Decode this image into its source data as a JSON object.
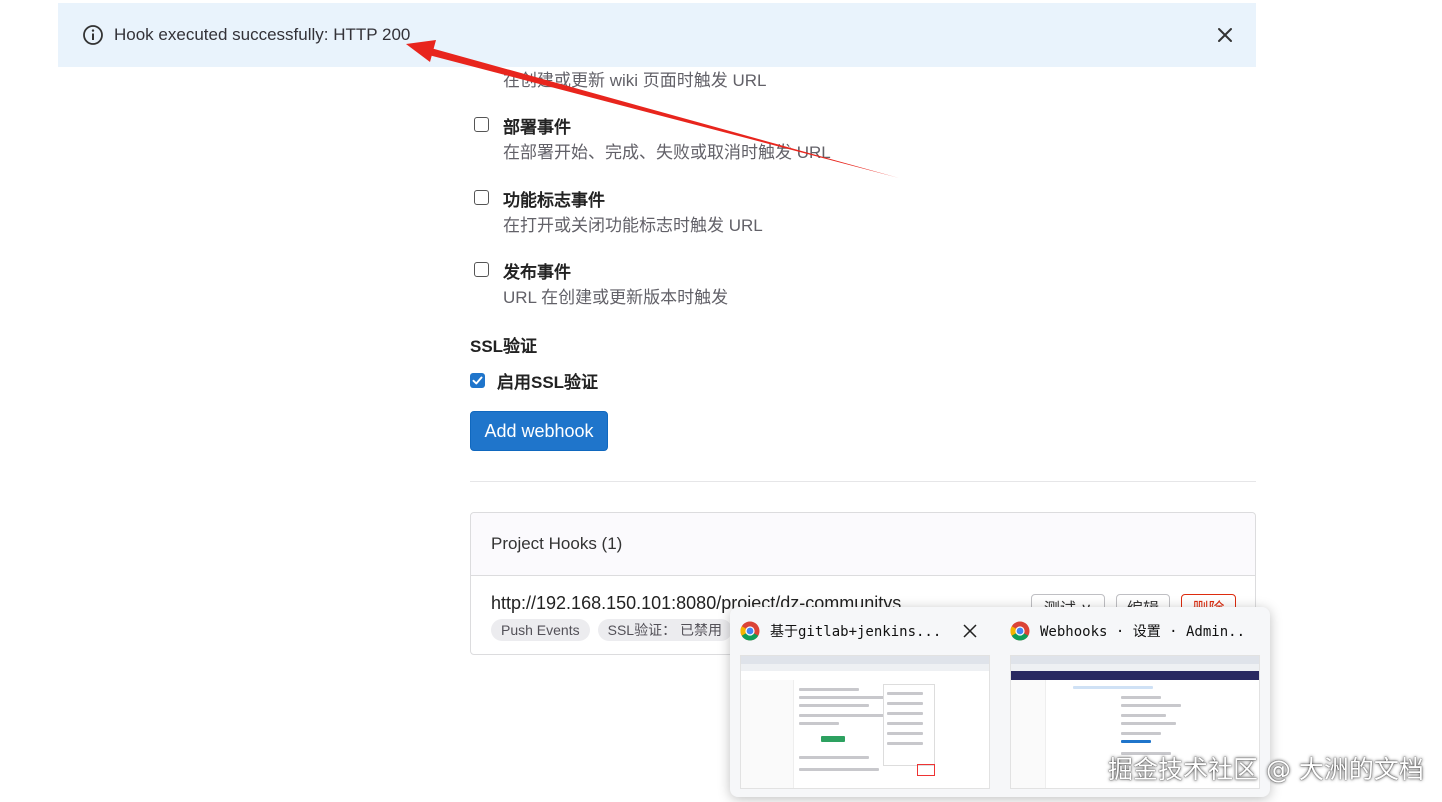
{
  "flash": {
    "message": "Hook executed successfully: HTTP 200"
  },
  "wiki_event": {
    "description": "在创建或更新 wiki 页面时触发 URL"
  },
  "events": [
    {
      "title": "部署事件",
      "description": "在部署开始、完成、失败或取消时触发 URL",
      "checked": false
    },
    {
      "title": "功能标志事件",
      "description": "在打开或关闭功能标志时触发 URL",
      "checked": false
    },
    {
      "title": "发布事件",
      "description": "URL 在创建或更新版本时触发",
      "checked": false
    }
  ],
  "ssl": {
    "heading": "SSL验证",
    "checkbox_label": "启用SSL验证",
    "checked": true
  },
  "add_button_label": "Add webhook",
  "project_hooks": {
    "title": "Project Hooks (1)",
    "hook": {
      "url": "http://192.168.150.101:8080/project/dz-communitys",
      "badges": [
        "Push Events",
        "SSL验证： 已禁用"
      ],
      "buttons": {
        "test": "测试 ∨",
        "edit": "编辑",
        "delete": "删除"
      }
    }
  },
  "taskbar_preview": {
    "items": [
      {
        "title": "基于gitlab+jenkins..."
      },
      {
        "title": "Webhooks · 设置 · Admin..."
      }
    ]
  },
  "watermark": "掘金技术社区 @ 大洲的文档",
  "colors": {
    "accent": "#1f75cb",
    "flash_bg": "#e9f3fc",
    "annotation": "#e8251d",
    "danger": "#dd2b0e"
  }
}
